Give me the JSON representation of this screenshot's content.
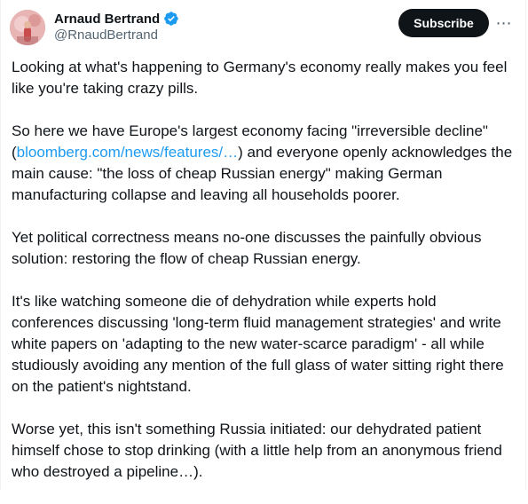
{
  "author": {
    "display_name": "Arnaud Bertrand",
    "handle": "@RnaudBertrand",
    "verified": true
  },
  "actions": {
    "subscribe_label": "Subscribe",
    "more_label": "⋯"
  },
  "tweet": {
    "p1": "Looking at what's happening to Germany's economy really makes you feel like you're taking crazy pills.",
    "p2_before": "So here we have Europe's largest economy facing \"irreversible decline\" (",
    "p2_link": "bloomberg.com/news/features/…",
    "p2_after": ") and everyone openly acknowledges the main cause: \"the loss of cheap Russian energy\" making German manufacturing collapse and leaving all households poorer.",
    "p3": "Yet political correctness means no-one discusses the painfully obvious solution: restoring the flow of cheap Russian energy.",
    "p4": "It's like watching someone die of dehydration while experts hold conferences discussing 'long-term fluid management strategies' and write white papers on 'adapting to the new water-scarce paradigm' - all while studiously avoiding any mention of the full glass of water sitting right there on the patient's nightstand.",
    "p5": "Worse yet, this isn't something Russia initiated: our dehydrated patient himself chose to stop drinking (with a little help from an anonymous friend who destroyed a pipeline…)."
  },
  "colors": {
    "text": "#0f1419",
    "secondary": "#536471",
    "link": "#1d9bf0",
    "verified": "#1d9bf0",
    "button_bg": "#0f1419"
  }
}
